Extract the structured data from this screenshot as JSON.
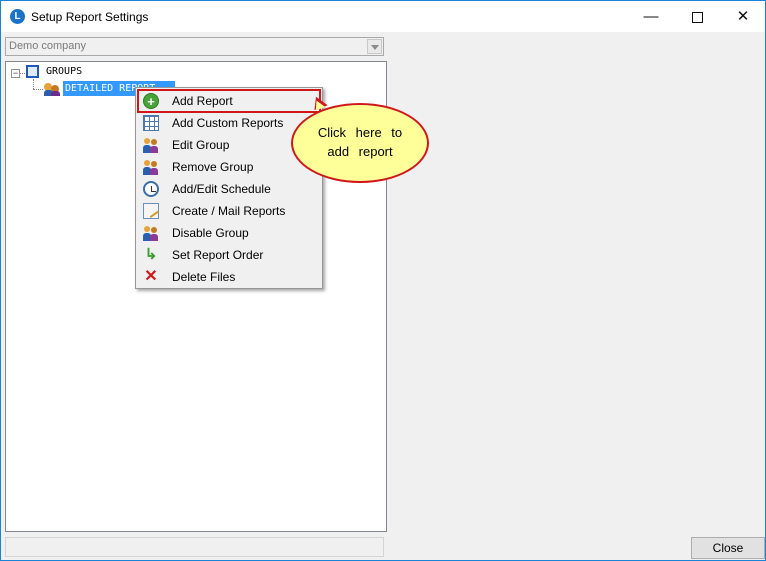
{
  "window": {
    "title": "Setup Report Settings",
    "icon": "app-logo-icon",
    "controls": {
      "minimize": "—",
      "maximize": "□",
      "close": "✕"
    }
  },
  "company_select": {
    "value": "Demo company"
  },
  "tree": {
    "root": {
      "label": "GROUPS",
      "expander": "−",
      "icon": "groups-folder-icon"
    },
    "children": [
      {
        "label": "DETAILED REPORT",
        "icon": "users-icon",
        "selected": true
      }
    ]
  },
  "context_menu": {
    "items": [
      {
        "label": "Add Report",
        "icon": "add-icon",
        "highlighted": true
      },
      {
        "label": "Add Custom Reports",
        "icon": "grid-icon"
      },
      {
        "label": "Edit Group",
        "icon": "edit-group-icon"
      },
      {
        "label": "Remove Group",
        "icon": "remove-group-icon"
      },
      {
        "label": "Add/Edit Schedule",
        "icon": "schedule-icon"
      },
      {
        "label": "Create / Mail Reports",
        "icon": "mail-icon"
      },
      {
        "label": "Disable Group",
        "icon": "disable-group-icon"
      },
      {
        "label": "Set Report Order",
        "icon": "order-icon"
      },
      {
        "label": "Delete Files",
        "icon": "delete-icon"
      }
    ]
  },
  "callout": {
    "line1": "Click here to",
    "line2": "add report"
  },
  "footer": {
    "close_label": "Close"
  },
  "colors": {
    "window_border": "#1883d7",
    "selection": "#3399ff",
    "highlight_border": "#d0181b",
    "callout_fill": "#ffff99"
  }
}
